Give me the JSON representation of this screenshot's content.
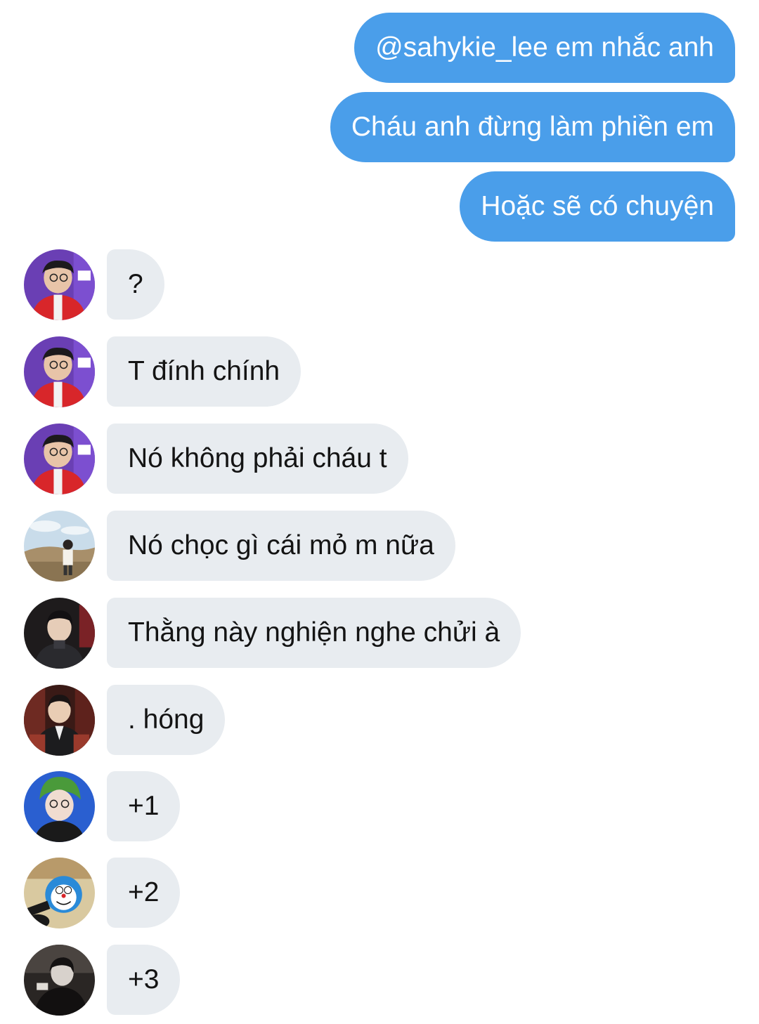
{
  "sent_messages": [
    {
      "text": "@sahykie_lee em nhắc anh"
    },
    {
      "text": "Cháu anh đừng làm phiền em"
    },
    {
      "text": "Hoặc sẽ có chuyện"
    }
  ],
  "received_messages": [
    {
      "text": "?",
      "avatar": "user-photo-red-jacket"
    },
    {
      "text": "T đính chính",
      "avatar": "user-photo-red-jacket"
    },
    {
      "text": "Nó không phải cháu t",
      "avatar": "user-photo-red-jacket"
    },
    {
      "text": "Nó chọc gì cái mỏ m nữa",
      "avatar": "user-photo-outdoor"
    },
    {
      "text": "Thằng này nghiện nghe chửi à",
      "avatar": "user-photo-dark"
    },
    {
      "text": ". hóng",
      "avatar": "user-photo-plaid"
    },
    {
      "text": "+1",
      "avatar": "user-photo-blue"
    },
    {
      "text": "+2",
      "avatar": "user-photo-cartoon"
    },
    {
      "text": "+3",
      "avatar": "user-photo-bw"
    }
  ],
  "colors": {
    "sent_bubble": "#4a9eea",
    "received_bubble": "#e8ecf0",
    "received_text": "#141414",
    "background": "#ffffff"
  }
}
